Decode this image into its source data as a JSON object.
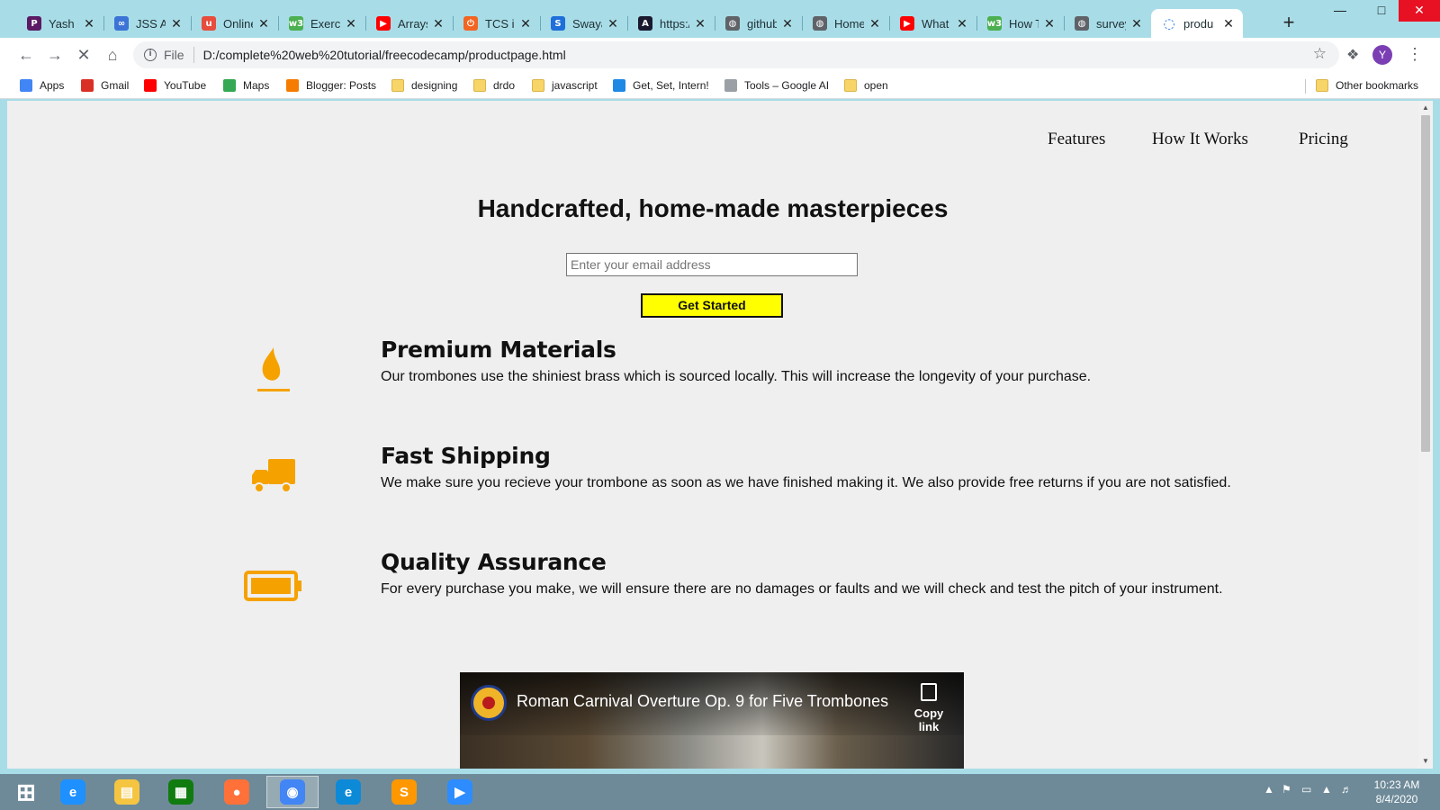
{
  "browser": {
    "tabs": [
      {
        "title": "Yash G",
        "icon": "p-icon",
        "color": "#5b1a63",
        "glyph": "P"
      },
      {
        "title": "JSS Ac",
        "icon": "infinity-icon",
        "color": "#3b73d6",
        "glyph": "∞"
      },
      {
        "title": "Online",
        "icon": "u-logo-icon",
        "color": "#e74c3c",
        "glyph": "u"
      },
      {
        "title": "Exercis",
        "icon": "w3-icon",
        "color": "#4caf50",
        "glyph": "w3"
      },
      {
        "title": "Arrays",
        "icon": "youtube-icon",
        "color": "#ff0000",
        "glyph": "▶"
      },
      {
        "title": "TCS iC",
        "icon": "power-icon",
        "color": "#f26522",
        "glyph": "⏻"
      },
      {
        "title": "Swaya",
        "icon": "s-icon",
        "color": "#1e6fd9",
        "glyph": "S"
      },
      {
        "title": "https:/",
        "icon": "angular-icon",
        "color": "#1a1a2e",
        "glyph": "A"
      },
      {
        "title": "github",
        "icon": "globe-icon",
        "color": "#5f6368",
        "glyph": "◍"
      },
      {
        "title": "Home",
        "icon": "globe-icon",
        "color": "#5f6368",
        "glyph": "◍"
      },
      {
        "title": "What i",
        "icon": "youtube-icon",
        "color": "#ff0000",
        "glyph": "▶"
      },
      {
        "title": "How T",
        "icon": "w3-icon",
        "color": "#4caf50",
        "glyph": "w3"
      },
      {
        "title": "survey",
        "icon": "globe-icon",
        "color": "#5f6368",
        "glyph": "◍"
      },
      {
        "title": "produ",
        "icon": "loading-spinner-icon",
        "color": "#1a73e8",
        "glyph": "◌",
        "active": true
      }
    ],
    "new_tab": "+",
    "url_scheme": "File",
    "url": "D:/complete%20web%20tutorial/freecodecamp/productpage.html",
    "avatar_letter": "Y",
    "bookmarks": [
      {
        "label": "Apps",
        "icon": "apps-grid-icon",
        "color": "#4285f4"
      },
      {
        "label": "Gmail",
        "icon": "gmail-icon",
        "color": "#d93025"
      },
      {
        "label": "YouTube",
        "icon": "youtube-icon",
        "color": "#ff0000"
      },
      {
        "label": "Maps",
        "icon": "maps-icon",
        "color": "#34a853"
      },
      {
        "label": "Blogger: Posts",
        "icon": "blogger-icon",
        "color": "#f57c00"
      },
      {
        "label": "designing",
        "icon": "folder-icon",
        "color": "#f8d568"
      },
      {
        "label": "drdo",
        "icon": "folder-icon",
        "color": "#f8d568"
      },
      {
        "label": "javascript",
        "icon": "folder-icon",
        "color": "#f8d568"
      },
      {
        "label": "Get, Set, Intern!",
        "icon": "is-icon",
        "color": "#1e88e5"
      },
      {
        "label": "Tools – Google AI",
        "icon": "google-ai-dots-icon",
        "color": "#9aa0a6"
      },
      {
        "label": "open",
        "icon": "folder-icon",
        "color": "#f8d568"
      }
    ],
    "other_bookmarks": "Other bookmarks"
  },
  "page": {
    "nav": [
      "Features",
      "How It Works",
      "Pricing"
    ],
    "hero_title": "Handcrafted, home-made masterpieces",
    "email_placeholder": "Enter your email address",
    "cta_label": "Get Started",
    "accent_color": "#f5a200",
    "features": [
      {
        "title": "Premium Materials",
        "text": "Our trombones use the shiniest brass which is sourced locally. This will increase the longevity of your purchase.",
        "icon": "fire-icon"
      },
      {
        "title": "Fast Shipping",
        "text": "We make sure you recieve your trombone as soon as we have finished making it. We also provide free returns if you are not satisfied.",
        "icon": "truck-icon"
      },
      {
        "title": "Quality Assurance",
        "text": "For every purchase you make, we will ensure there are no damages or faults and we will check and test the pitch of your instrument.",
        "icon": "battery-full-icon"
      }
    ],
    "video": {
      "title": "Roman Carnival Overture Op. 9 for Five Trombones",
      "copy_label": "Copy link"
    }
  },
  "taskbar": {
    "apps": [
      {
        "name": "windows-start",
        "color": "#ffffff"
      },
      {
        "name": "internet-explorer",
        "color": "#1e90ff"
      },
      {
        "name": "file-explorer",
        "color": "#f5c542"
      },
      {
        "name": "store",
        "color": "#107c10"
      },
      {
        "name": "firefox",
        "color": "#ff7139"
      },
      {
        "name": "chrome",
        "color": "#4285f4"
      },
      {
        "name": "edge",
        "color": "#0c8ad8"
      },
      {
        "name": "sublime-text",
        "color": "#ff9800"
      },
      {
        "name": "zoom",
        "color": "#2d8cff"
      }
    ],
    "time": "10:23 AM",
    "date": "8/4/2020"
  }
}
